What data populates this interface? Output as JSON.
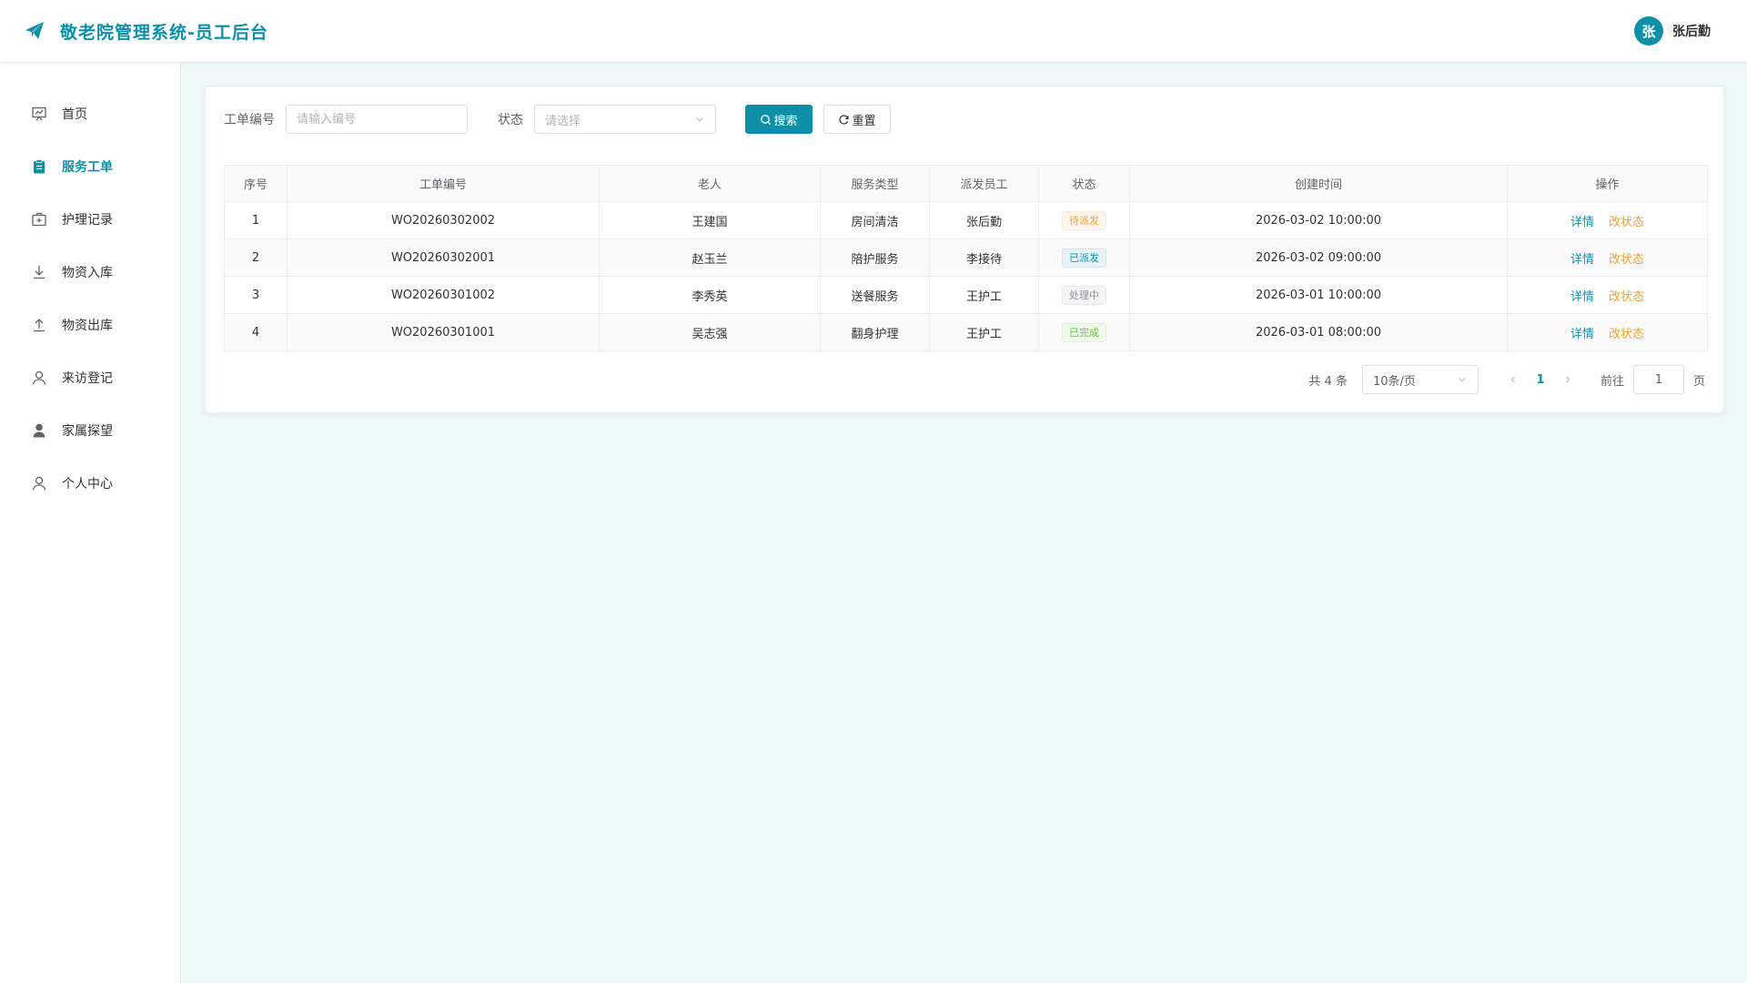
{
  "header": {
    "title": "敬老院管理系统-员工后台",
    "user": {
      "avatar_text": "张",
      "name": "张后勤"
    }
  },
  "sidebar": {
    "items": [
      {
        "label": "首页",
        "icon": "dashboard-icon",
        "active": false
      },
      {
        "label": "服务工单",
        "icon": "clipboard-icon",
        "active": true
      },
      {
        "label": "护理记录",
        "icon": "first-aid-kit-icon",
        "active": false
      },
      {
        "label": "物资入库",
        "icon": "download-icon",
        "active": false
      },
      {
        "label": "物资出库",
        "icon": "upload-icon",
        "active": false
      },
      {
        "label": "来访登记",
        "icon": "user-icon",
        "active": false
      },
      {
        "label": "家属探望",
        "icon": "user-filled-icon",
        "active": false
      },
      {
        "label": "个人中心",
        "icon": "user-icon",
        "active": false
      }
    ]
  },
  "filters": {
    "order_no_label": "工单编号",
    "order_no_placeholder": "请输入编号",
    "status_label": "状态",
    "status_placeholder": "请选择",
    "search_label": "搜索",
    "reset_label": "重置"
  },
  "table": {
    "columns": [
      "序号",
      "工单编号",
      "老人",
      "服务类型",
      "派发员工",
      "状态",
      "创建时间",
      "操作"
    ],
    "rows": [
      {
        "index": "1",
        "order_no": "WO20260302002",
        "elder": "王建国",
        "service": "房间清洁",
        "staff": "张后勤",
        "status": "待派发",
        "status_type": "warning",
        "created": "2026-03-02 10:00:00"
      },
      {
        "index": "2",
        "order_no": "WO20260302001",
        "elder": "赵玉兰",
        "service": "陪护服务",
        "staff": "李接待",
        "status": "已派发",
        "status_type": "primary",
        "created": "2026-03-02 09:00:00"
      },
      {
        "index": "3",
        "order_no": "WO20260301002",
        "elder": "李秀英",
        "service": "送餐服务",
        "staff": "王护工",
        "status": "处理中",
        "status_type": "info",
        "created": "2026-03-01 10:00:00"
      },
      {
        "index": "4",
        "order_no": "WO20260301001",
        "elder": "吴志强",
        "service": "翻身护理",
        "staff": "王护工",
        "status": "已完成",
        "status_type": "success",
        "created": "2026-03-01 08:00:00"
      }
    ],
    "actions": {
      "detail": "详情",
      "change_status": "改状态"
    }
  },
  "pagination": {
    "total": "共 4 条",
    "page_size": "10条/页",
    "current_page": "1",
    "goto_label": "前往",
    "goto_value": "1",
    "page_unit": "页"
  },
  "colors": {
    "accent": "#0e8fa8",
    "background": "#f0faf8",
    "warning": "#e6a23c",
    "success": "#67c23a",
    "info": "#909399"
  }
}
